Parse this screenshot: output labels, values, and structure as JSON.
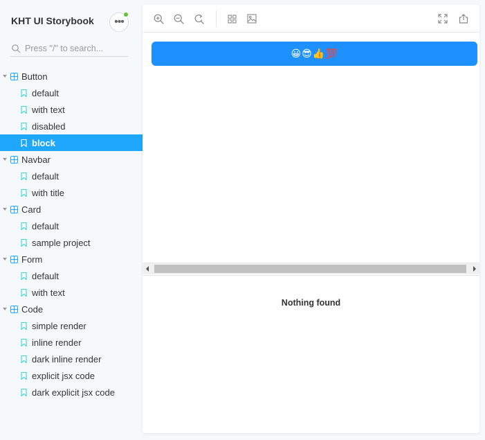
{
  "sidebar": {
    "title": "KHT UI Storybook",
    "menu_icon": "ellipsis-icon",
    "search": {
      "placeholder": "Press \"/\" to search..."
    },
    "groups": [
      {
        "label": "Button",
        "stories": [
          "default",
          "with text",
          "disabled",
          "block"
        ]
      },
      {
        "label": "Navbar",
        "stories": [
          "default",
          "with title"
        ]
      },
      {
        "label": "Card",
        "stories": [
          "default",
          "sample project"
        ]
      },
      {
        "label": "Form",
        "stories": [
          "default",
          "with text"
        ]
      },
      {
        "label": "Code",
        "stories": [
          "simple render",
          "inline render",
          "dark inline render",
          "explicit jsx code",
          "dark explicit jsx code"
        ]
      }
    ],
    "selected_story": "block"
  },
  "toolbar": {
    "left_tools": [
      "zoom-in-icon",
      "zoom-out-icon",
      "reset-zoom-icon",
      "grid-icon",
      "image-icon"
    ],
    "right_tools": [
      "fullscreen-icon",
      "share-icon"
    ]
  },
  "preview": {
    "block_button_label": "😀😎👍💯"
  },
  "addons": {
    "empty_text": "Nothing found"
  },
  "colors": {
    "accent": "#1ea7fd",
    "block_button": "#1e90ff",
    "status_dot": "#66bf3c"
  }
}
